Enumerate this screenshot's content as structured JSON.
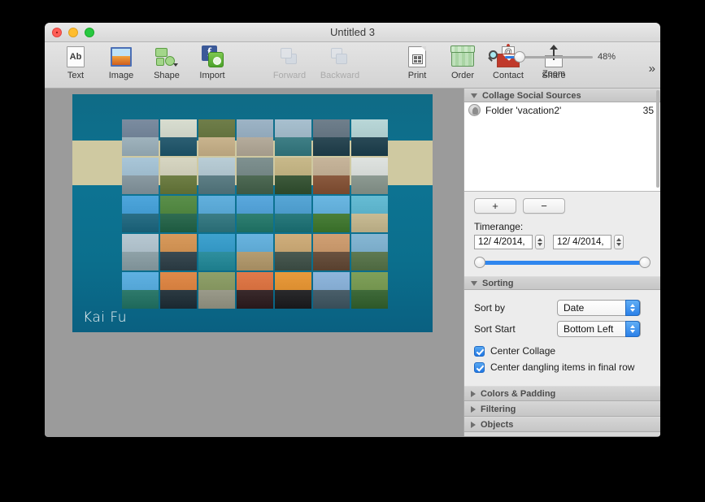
{
  "window": {
    "title": "Untitled 3",
    "traffic_lights": [
      "close-button",
      "minimize-button",
      "maximize-button"
    ]
  },
  "toolbar": {
    "items": [
      {
        "label": "Text",
        "icon": "text-icon",
        "disabled": false
      },
      {
        "label": "Image",
        "icon": "image-icon",
        "disabled": false
      },
      {
        "label": "Shape",
        "icon": "shape-icon",
        "disabled": false
      },
      {
        "label": "Import",
        "icon": "import-icon",
        "disabled": false
      },
      {
        "label": "Forward",
        "icon": "forward-icon",
        "disabled": true
      },
      {
        "label": "Backward",
        "icon": "backward-icon",
        "disabled": true
      },
      {
        "label": "Print",
        "icon": "print-icon",
        "disabled": false
      },
      {
        "label": "Order",
        "icon": "order-icon",
        "disabled": false
      },
      {
        "label": "Contact",
        "icon": "contact-icon",
        "disabled": false
      },
      {
        "label": "Share",
        "icon": "share-icon",
        "disabled": false
      }
    ],
    "zoom": {
      "label": "Zoom",
      "value": "48%",
      "percent": 48,
      "magnify_icon": "magnifier-icon"
    },
    "overflow_label": "»"
  },
  "canvas": {
    "signature": "Kai Fu",
    "background_top": "#0f6b86",
    "background_bottom": "#0a6081",
    "band_color": "#cfc9a1",
    "matte_color": "#9b9b9b",
    "grid": {
      "columns": 7,
      "rows": 5,
      "tiles": [
        {
          "sky": "#7b8ca0",
          "land": "#9fb3bd"
        },
        {
          "sky": "#d8ddd0",
          "land": "#2c5f73"
        },
        {
          "sky": "#6f7e4a",
          "land": "#c9b48e"
        },
        {
          "sky": "#9db4c6",
          "land": "#b5ac9c"
        },
        {
          "sky": "#a8c0cf",
          "land": "#3f7f86"
        },
        {
          "sky": "#6f7f8c",
          "land": "#2d4a56"
        },
        {
          "sky": "#b9d7d8",
          "land": "#2a4a57"
        },
        {
          "sky": "#a9c6d8",
          "land": "#8a9aa2"
        },
        {
          "sky": "#d7d6c2",
          "land": "#6f7f46"
        },
        {
          "sky": "#b9cdd6",
          "land": "#5e7f86"
        },
        {
          "sky": "#7f9190",
          "land": "#4f6a55"
        },
        {
          "sky": "#c8b98a",
          "land": "#3e5a3c"
        },
        {
          "sky": "#c7b59b",
          "land": "#8a5a3f"
        },
        {
          "sky": "#dfe3e0",
          "land": "#8d9a92"
        },
        {
          "sky": "#4ea6dc",
          "land": "#2a6f86"
        },
        {
          "sky": "#5a8f4a",
          "land": "#2f6c52"
        },
        {
          "sky": "#62b0dd",
          "land": "#3b7d86"
        },
        {
          "sky": "#5aa8dd",
          "land": "#2f7f72"
        },
        {
          "sky": "#57a6d6",
          "land": "#2a7a7d"
        },
        {
          "sky": "#6bb7e2",
          "land": "#4a7f3a"
        },
        {
          "sky": "#66bcd4",
          "land": "#c8bb94"
        },
        {
          "sky": "#b7c8d2",
          "land": "#8fa2a8"
        },
        {
          "sky": "#d89a5c",
          "land": "#3a4a52"
        },
        {
          "sky": "#3fa2cf",
          "land": "#2f8f9e"
        },
        {
          "sky": "#69b4df",
          "land": "#b59d72"
        },
        {
          "sky": "#cfae7c",
          "land": "#4a5a52"
        },
        {
          "sky": "#d0a074",
          "land": "#6a5240"
        },
        {
          "sky": "#86b7d4",
          "land": "#5f7a52"
        },
        {
          "sky": "#5fb1e2",
          "land": "#2f7a6c"
        },
        {
          "sky": "#e08a4a",
          "land": "#2c3a42"
        },
        {
          "sky": "#8fa06a",
          "land": "#9a9a8a"
        },
        {
          "sky": "#e07a4a",
          "land": "#3a2a2c"
        },
        {
          "sky": "#e89a3c",
          "land": "#2a2a2c"
        },
        {
          "sky": "#8fb6dc",
          "land": "#4a5f6a"
        },
        {
          "sky": "#7fa05a",
          "land": "#3f6a3a"
        }
      ]
    }
  },
  "sidebar": {
    "sections": [
      {
        "title": "Collage Social Sources",
        "expanded": true
      },
      {
        "title": "Sorting",
        "expanded": true
      },
      {
        "title": "Colors & Padding",
        "expanded": false
      },
      {
        "title": "Filtering",
        "expanded": false
      },
      {
        "title": "Objects",
        "expanded": false
      }
    ],
    "sources": {
      "rows": [
        {
          "icon": "contact-person-icon",
          "name": "Folder 'vacation2'",
          "count": "35"
        }
      ],
      "add_label": "+",
      "remove_label": "−"
    },
    "timerange": {
      "label": "Timerange:",
      "start": "12/  4/2014,",
      "end": "12/  4/2014,"
    },
    "sorting": {
      "sort_by_label": "Sort by",
      "sort_by_value": "Date",
      "sort_start_label": "Sort Start",
      "sort_start_value": "Bottom Left",
      "checkboxes": [
        {
          "label": "Center Collage",
          "checked": true
        },
        {
          "label": "Center dangling items in final row",
          "checked": true
        }
      ]
    }
  }
}
